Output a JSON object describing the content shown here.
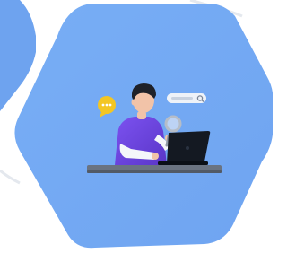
{
  "colors": {
    "background": "#ffffff",
    "hexagon_top": "#78AEF5",
    "hexagon_bottom": "#6FA4F1",
    "partial_hexagon": "#6EA3EF",
    "decorative_curve": "#E4E8EE",
    "shirt": "#6E44E6",
    "skin": "#F2C3A8",
    "hair": "#1E2129",
    "desk": "#6A7381",
    "laptop": "#141922",
    "magnifier": "#B6BDC8",
    "chat_bubble": "#F3C623"
  },
  "illustration": {
    "subject": "person-searching-on-laptop",
    "icons": [
      "chat-bubble-icon",
      "search-bar-icon",
      "magnifier-icon",
      "laptop-icon"
    ]
  }
}
